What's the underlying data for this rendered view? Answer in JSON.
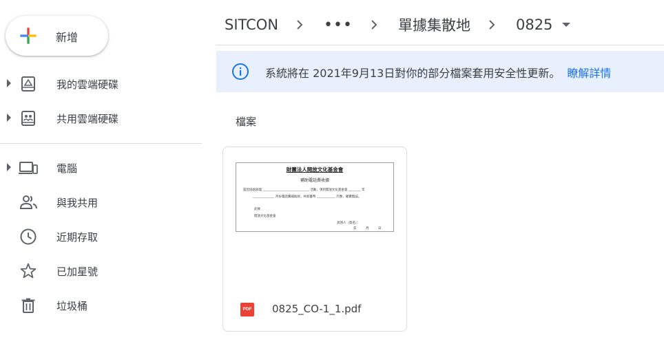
{
  "sidebar": {
    "new_label": "新增",
    "items": [
      {
        "label": "我的雲端硬碟",
        "icon": "my-drive-icon",
        "expandable": true
      },
      {
        "label": "共用雲端硬碟",
        "icon": "shared-drives-icon",
        "expandable": true
      },
      {
        "label": "電腦",
        "icon": "computers-icon",
        "expandable": true
      },
      {
        "label": "與我共用",
        "icon": "shared-with-me-icon",
        "expandable": false
      },
      {
        "label": "近期存取",
        "icon": "recent-icon",
        "expandable": false
      },
      {
        "label": "已加星號",
        "icon": "starred-icon",
        "expandable": false
      },
      {
        "label": "垃圾桶",
        "icon": "trash-icon",
        "expandable": false
      }
    ]
  },
  "breadcrumb": {
    "root": "SITCON",
    "ellipsis": "•••",
    "parent": "單據集散地",
    "current": "0825"
  },
  "banner": {
    "message": "系統將在 2021年9月13日對你的部分檔案套用安全性更新。",
    "link": "瞭解詳情"
  },
  "section": {
    "title": "檔案"
  },
  "file": {
    "name": "0825_CO-1_1.pdf",
    "type_badge": "PDF",
    "preview": {
      "title": "財團法人開放文化基金會",
      "subtitle": "補助電話費收據",
      "line1": "茲因協助辦理 ______________________________ 活動，領到開放文化基金會 ________ 年",
      "line2": "______________ 月份電話費補助款，共新臺幣 ____________ 元整，確實無誤。",
      "line3": "此致",
      "line4": "開放文化基金會",
      "line5": "具領人（簽名）：",
      "line6": "年　　　月　　　日"
    }
  },
  "colors": {
    "accent_blue": "#1a73e8",
    "banner_bg": "#e8f0fe",
    "pdf_red": "#ea4335"
  }
}
